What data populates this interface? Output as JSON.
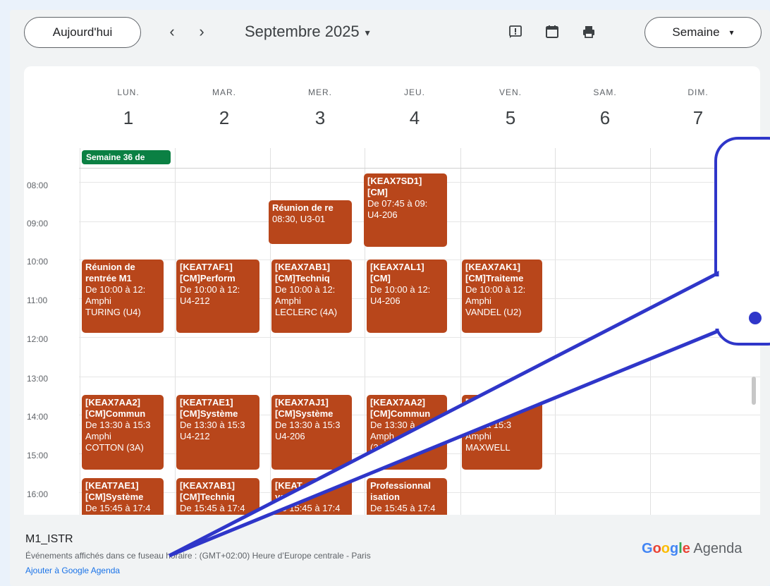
{
  "colors": {
    "event": "#b8461b",
    "allday": "#0b8043",
    "accent": "#1a73e8",
    "callout": "#2f36c9"
  },
  "toolbar": {
    "today_label": "Aujourd'hui",
    "prev_icon": "‹",
    "next_icon": "›",
    "month_label": "Septembre 2025",
    "month_caret": "▾",
    "view_label": "Semaine",
    "view_caret": "▾",
    "icons": [
      "feedback-icon",
      "calendar-icon",
      "print-icon"
    ]
  },
  "days": [
    {
      "dow": "LUN.",
      "num": "1"
    },
    {
      "dow": "MAR.",
      "num": "2"
    },
    {
      "dow": "MER.",
      "num": "3"
    },
    {
      "dow": "JEU.",
      "num": "4"
    },
    {
      "dow": "VEN.",
      "num": "5"
    },
    {
      "dow": "SAM.",
      "num": "6"
    },
    {
      "dow": "DIM.",
      "num": "7"
    }
  ],
  "all_day_event": "Semaine 36 de",
  "hours": [
    "08:00",
    "09:00",
    "10:00",
    "11:00",
    "12:00",
    "13:00",
    "14:00",
    "15:00",
    "16:00"
  ],
  "events": {
    "e01": [
      "Réunion de re",
      "08:30, U3-01"
    ],
    "e02": [
      "[KEAX7SD1]",
      "[CM]",
      "De 07:45 à 09:",
      "U4-206"
    ],
    "e03": [
      "Réunion de",
      "rentrée M1",
      "De 10:00 à 12:",
      "Amphi",
      "TURING (U4)"
    ],
    "e04": [
      "[KEAT7AF1]",
      "[CM]Perform",
      "De 10:00 à 12:",
      "U4-212"
    ],
    "e05": [
      "[KEAX7AB1]",
      "[CM]Techniq",
      "De 10:00 à 12:",
      "Amphi",
      "LECLERC (4A)"
    ],
    "e06": [
      "[KEAX7AL1]",
      "[CM]",
      "De 10:00 à 12:",
      "U4-206"
    ],
    "e07": [
      "[KEAX7AK1]",
      "[CM]Traiteme",
      "De 10:00 à 12:",
      "Amphi",
      "VANDEL (U2)"
    ],
    "e08": [
      "[KEAX7AA2]",
      "[CM]Commun",
      "De 13:30 à 15:3",
      "Amphi",
      "COTTON (3A)"
    ],
    "e09": [
      "[KEAT7AE1]",
      "[CM]Système",
      "De 13:30 à 15:3",
      "U4-212"
    ],
    "e10": [
      "[KEAX7AJ1]",
      "[CM]Système",
      "De 13:30 à 15:3",
      "U4-206"
    ],
    "e11": [
      "[KEAX7AA2]",
      "[CM]Commun",
      "De 13:30 à",
      "Amph",
      "(3A)"
    ],
    "e12": [
      "[K",
      "me",
      "3:30 à 15:3",
      "Amphi",
      "MAXWELL"
    ],
    "e13": [
      "[KEAT7AE1]",
      "[CM]Système",
      "De 15:45 à 17:4"
    ],
    "e14": [
      "[KEAX7AB1]",
      "[CM]Techniq",
      "De 15:45 à 17:4"
    ],
    "e15": [
      "[KEAT",
      "ystème",
      "De 15:45 à 17:4"
    ],
    "e16": [
      "Professionnal",
      "isation",
      "De 15:45 à 17:4"
    ]
  },
  "footer": {
    "calendar_name": "M1_ISTR",
    "timezone": "Événements affichés dans ce fuseau horaire : (GMT+02:00) Heure d’Europe centrale - Paris",
    "add_link": "Ajouter à Google Agenda",
    "brand_google": "Google",
    "brand_agenda": " Agenda"
  }
}
